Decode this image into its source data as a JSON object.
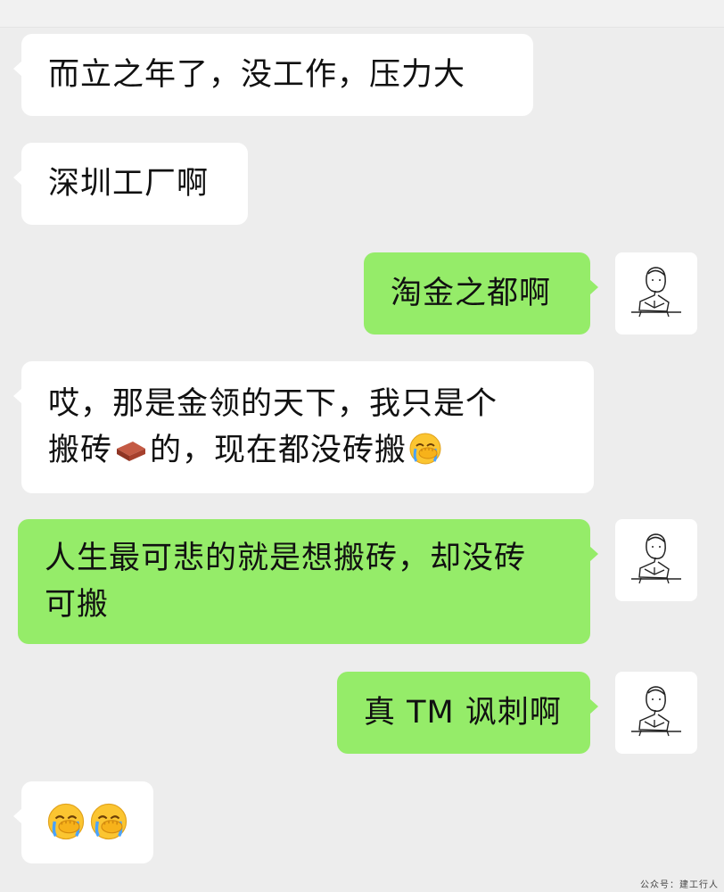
{
  "messages": [
    {
      "side": "left",
      "lines": [
        "而立之年了，没工作，压力大"
      ]
    },
    {
      "side": "left",
      "lines": [
        "深圳工厂啊"
      ]
    },
    {
      "side": "right",
      "lines": [
        "淘金之都啊"
      ],
      "avatar": "reading-girl-sketch-icon"
    },
    {
      "side": "left",
      "lines": [
        "哎，那是金领的天下，我只是个",
        "搬砖",
        "的，现在都没砖搬"
      ],
      "emojis": [
        "brick-emoji",
        "facepalm-emoji"
      ]
    },
    {
      "side": "right",
      "lines": [
        "人生最可悲的就是想搬砖，却没砖",
        "可搬"
      ],
      "avatar": "reading-girl-sketch-icon"
    },
    {
      "side": "right",
      "lines": [
        "真 TM 讽刺啊"
      ],
      "avatar": "reading-girl-sketch-icon"
    },
    {
      "side": "left",
      "lines": [],
      "emojis": [
        "facepalm-emoji",
        "facepalm-emoji"
      ]
    }
  ],
  "watermark": "公众号：建工行人",
  "colors": {
    "background": "#ededed",
    "incoming_bubble": "#ffffff",
    "outgoing_bubble": "#95ec69"
  }
}
